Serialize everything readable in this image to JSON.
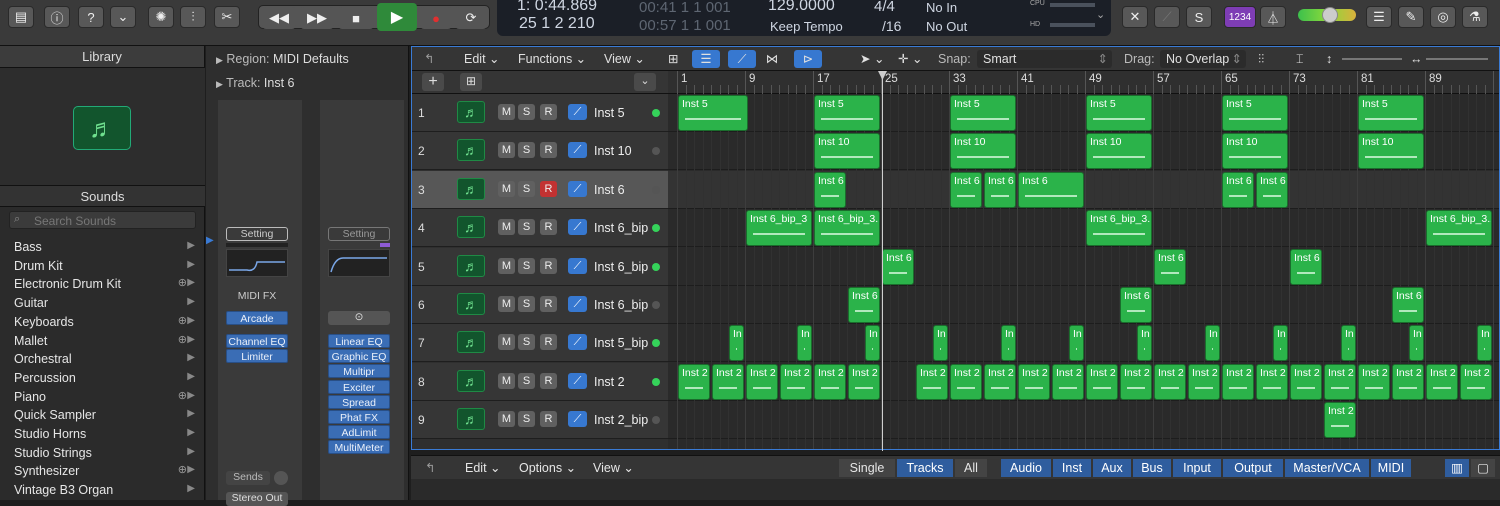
{
  "lcd": {
    "position_time": "1:  0:44.869",
    "position_bars": "25  1  2  210",
    "ghost_time": "00:41  1  1  001",
    "ghost_bars": "00:57  1  1  001",
    "tempo": "129.0000",
    "tempo_mode": "Keep Tempo",
    "sig_top": "4/4",
    "sig_bottom": "/16",
    "in_label": "No In",
    "out_label": "No Out",
    "cpu_label": "CPU",
    "hd_label": "HD",
    "count_in": "1234"
  },
  "library": {
    "title": "Library",
    "sounds_label": "Sounds",
    "search_placeholder": "Search Sounds",
    "items": [
      {
        "label": "Bass",
        "dl": false
      },
      {
        "label": "Drum Kit",
        "dl": false
      },
      {
        "label": "Electronic Drum Kit",
        "dl": true
      },
      {
        "label": "Guitar",
        "dl": false
      },
      {
        "label": "Keyboards",
        "dl": true
      },
      {
        "label": "Mallet",
        "dl": true
      },
      {
        "label": "Orchestral",
        "dl": false
      },
      {
        "label": "Percussion",
        "dl": false
      },
      {
        "label": "Piano",
        "dl": true
      },
      {
        "label": "Quick Sampler",
        "dl": false
      },
      {
        "label": "Studio Horns",
        "dl": false
      },
      {
        "label": "Studio Strings",
        "dl": false
      },
      {
        "label": "Synthesizer",
        "dl": true
      },
      {
        "label": "Vintage B3 Organ",
        "dl": false
      }
    ]
  },
  "inspector": {
    "region_label": "Region:",
    "region_name": "MIDI Defaults",
    "track_label": "Track:",
    "track_name": "Inst 6",
    "setting": "Setting",
    "midi_fx": "MIDI FX",
    "arcade": "Arcade",
    "plugins_left": [
      "Channel EQ",
      "Limiter"
    ],
    "plugins_right": [
      "Linear EQ",
      "Graphic EQ",
      "Multipr",
      "Exciter",
      "Spread",
      "Phat FX",
      "AdLimit",
      "MultiMeter"
    ],
    "sends": "Sends",
    "stereo_out": "Stereo Out"
  },
  "tracks_toolbar": {
    "edit": "Edit",
    "functions": "Functions",
    "view": "View",
    "snap_label": "Snap:",
    "snap_value": "Smart",
    "drag_label": "Drag:",
    "drag_value": "No Overlap"
  },
  "ruler": [
    "1",
    "9",
    "17",
    "25",
    "33",
    "41",
    "49",
    "57",
    "65",
    "73",
    "81",
    "89"
  ],
  "tracks": [
    {
      "num": "1",
      "name": "Inst 5",
      "rec": false,
      "led": "#35d35a"
    },
    {
      "num": "2",
      "name": "Inst 10",
      "rec": false,
      "led": "#555555"
    },
    {
      "num": "3",
      "name": "Inst 6",
      "rec": true,
      "led": "#555555"
    },
    {
      "num": "4",
      "name": "Inst 6_bip",
      "rec": false,
      "led": "#35d35a"
    },
    {
      "num": "5",
      "name": "Inst 6_bip",
      "rec": false,
      "led": "#35d35a"
    },
    {
      "num": "6",
      "name": "Inst 6_bip",
      "rec": false,
      "led": "#555555"
    },
    {
      "num": "7",
      "name": "Inst 5_bip",
      "rec": false,
      "led": "#35d35a"
    },
    {
      "num": "8",
      "name": "Inst 2",
      "rec": false,
      "led": "#35d35a"
    },
    {
      "num": "9",
      "name": "Inst 2_bip",
      "rec": false,
      "led": "#555555"
    }
  ],
  "msr": {
    "m": "M",
    "s": "S",
    "r": "R"
  },
  "regions": [
    {
      "lane": 0,
      "bar": 1,
      "len": 8.5,
      "name": "Inst 5"
    },
    {
      "lane": 0,
      "bar": 17,
      "len": 8,
      "name": "Inst 5"
    },
    {
      "lane": 0,
      "bar": 33,
      "len": 8,
      "name": "Inst 5"
    },
    {
      "lane": 0,
      "bar": 49,
      "len": 8,
      "name": "Inst 5"
    },
    {
      "lane": 0,
      "bar": 65,
      "len": 8,
      "name": "Inst 5"
    },
    {
      "lane": 0,
      "bar": 81,
      "len": 8,
      "name": "Inst 5"
    },
    {
      "lane": 1,
      "bar": 17,
      "len": 8,
      "name": "Inst 10"
    },
    {
      "lane": 1,
      "bar": 33,
      "len": 8,
      "name": "Inst 10"
    },
    {
      "lane": 1,
      "bar": 49,
      "len": 8,
      "name": "Inst 10"
    },
    {
      "lane": 1,
      "bar": 65,
      "len": 8,
      "name": "Inst 10"
    },
    {
      "lane": 1,
      "bar": 81,
      "len": 8,
      "name": "Inst 10"
    },
    {
      "lane": 2,
      "bar": 17,
      "len": 4,
      "name": "Inst 6"
    },
    {
      "lane": 2,
      "bar": 33,
      "len": 4,
      "name": "Inst 6"
    },
    {
      "lane": 2,
      "bar": 37,
      "len": 4,
      "name": "Inst 6"
    },
    {
      "lane": 2,
      "bar": 41,
      "len": 8,
      "name": "Inst 6"
    },
    {
      "lane": 2,
      "bar": 65,
      "len": 4,
      "name": "Inst 6"
    },
    {
      "lane": 2,
      "bar": 69,
      "len": 4,
      "name": "Inst 6"
    },
    {
      "lane": 3,
      "bar": 9,
      "len": 8,
      "name": "Inst 6_bip_3"
    },
    {
      "lane": 3,
      "bar": 17,
      "len": 8,
      "name": "Inst 6_bip_3."
    },
    {
      "lane": 3,
      "bar": 49,
      "len": 8,
      "name": "Inst 6_bip_3."
    },
    {
      "lane": 3,
      "bar": 89,
      "len": 8,
      "name": "Inst 6_bip_3.1"
    },
    {
      "lane": 4,
      "bar": 25,
      "len": 4,
      "name": "Inst 6"
    },
    {
      "lane": 4,
      "bar": 57,
      "len": 4,
      "name": "Inst 6"
    },
    {
      "lane": 4,
      "bar": 73,
      "len": 4,
      "name": "Inst 6"
    },
    {
      "lane": 5,
      "bar": 21,
      "len": 4,
      "name": "Inst 6"
    },
    {
      "lane": 5,
      "bar": 53,
      "len": 4,
      "name": "Inst 6"
    },
    {
      "lane": 5,
      "bar": 85,
      "len": 4,
      "name": "Inst 6"
    },
    {
      "lane": 6,
      "bar": 7,
      "len": 2,
      "name": "In"
    },
    {
      "lane": 6,
      "bar": 15,
      "len": 2,
      "name": "In"
    },
    {
      "lane": 6,
      "bar": 23,
      "len": 2,
      "name": "In"
    },
    {
      "lane": 6,
      "bar": 31,
      "len": 2,
      "name": "In"
    },
    {
      "lane": 6,
      "bar": 39,
      "len": 2,
      "name": "In"
    },
    {
      "lane": 6,
      "bar": 47,
      "len": 2,
      "name": "In"
    },
    {
      "lane": 6,
      "bar": 55,
      "len": 2,
      "name": "In"
    },
    {
      "lane": 6,
      "bar": 63,
      "len": 2,
      "name": "In"
    },
    {
      "lane": 6,
      "bar": 71,
      "len": 2,
      "name": "In"
    },
    {
      "lane": 6,
      "bar": 79,
      "len": 2,
      "name": "In"
    },
    {
      "lane": 6,
      "bar": 87,
      "len": 2,
      "name": "In"
    },
    {
      "lane": 6,
      "bar": 95,
      "len": 2,
      "name": "In"
    },
    {
      "lane": 7,
      "bar": 1,
      "len": 4,
      "name": "Inst 2"
    },
    {
      "lane": 7,
      "bar": 5,
      "len": 4,
      "name": "Inst 2"
    },
    {
      "lane": 7,
      "bar": 9,
      "len": 4,
      "name": "Inst 2"
    },
    {
      "lane": 7,
      "bar": 13,
      "len": 4,
      "name": "Inst 2"
    },
    {
      "lane": 7,
      "bar": 17,
      "len": 4,
      "name": "Inst 2"
    },
    {
      "lane": 7,
      "bar": 21,
      "len": 4,
      "name": "Inst 2"
    },
    {
      "lane": 7,
      "bar": 29,
      "len": 4,
      "name": "Inst 2"
    },
    {
      "lane": 7,
      "bar": 33,
      "len": 4,
      "name": "Inst 2"
    },
    {
      "lane": 7,
      "bar": 37,
      "len": 4,
      "name": "Inst 2"
    },
    {
      "lane": 7,
      "bar": 41,
      "len": 4,
      "name": "Inst 2"
    },
    {
      "lane": 7,
      "bar": 45,
      "len": 4,
      "name": "Inst 2"
    },
    {
      "lane": 7,
      "bar": 49,
      "len": 4,
      "name": "Inst 2"
    },
    {
      "lane": 7,
      "bar": 53,
      "len": 4,
      "name": "Inst 2"
    },
    {
      "lane": 7,
      "bar": 57,
      "len": 4,
      "name": "Inst 2"
    },
    {
      "lane": 7,
      "bar": 61,
      "len": 4,
      "name": "Inst 2"
    },
    {
      "lane": 7,
      "bar": 65,
      "len": 4,
      "name": "Inst 2"
    },
    {
      "lane": 7,
      "bar": 69,
      "len": 4,
      "name": "Inst 2"
    },
    {
      "lane": 7,
      "bar": 73,
      "len": 4,
      "name": "Inst 2"
    },
    {
      "lane": 7,
      "bar": 77,
      "len": 4,
      "name": "Inst 2"
    },
    {
      "lane": 7,
      "bar": 81,
      "len": 4,
      "name": "Inst 2"
    },
    {
      "lane": 7,
      "bar": 85,
      "len": 4,
      "name": "Inst 2"
    },
    {
      "lane": 7,
      "bar": 89,
      "len": 4,
      "name": "Inst 2"
    },
    {
      "lane": 7,
      "bar": 93,
      "len": 4,
      "name": "Inst 2"
    },
    {
      "lane": 8,
      "bar": 77,
      "len": 4,
      "name": "Inst 2"
    }
  ],
  "bottom": {
    "edit": "Edit",
    "options": "Options",
    "view": "View",
    "single": "Single",
    "tracks": "Tracks",
    "all": "All",
    "filters": [
      "Audio",
      "Inst",
      "Aux",
      "Bus",
      "Input",
      "Output",
      "Master/VCA",
      "MIDI"
    ]
  },
  "colors": {
    "region_green": "#2bb34a",
    "accent_blue": "#3a7bd5",
    "record_red": "#c23232"
  }
}
